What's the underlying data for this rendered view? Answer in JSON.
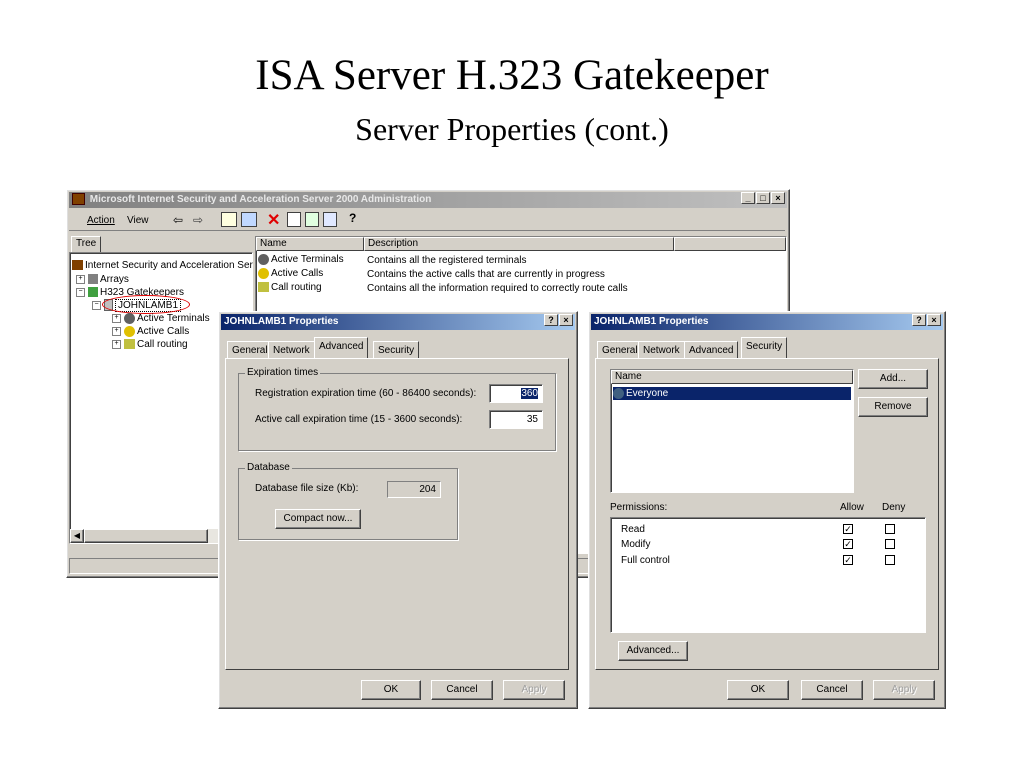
{
  "slide": {
    "title": "ISA Server H.323 Gatekeeper",
    "subtitle": "Server Properties (cont.)"
  },
  "mmc": {
    "title": "Microsoft Internet Security and Acceleration Server 2000 Administration",
    "menu": {
      "action": "Action",
      "view": "View"
    },
    "tree_tab": "Tree",
    "tree": {
      "root": "Internet Security and Acceleration Ser",
      "arrays": "Arrays",
      "gatekeepers": "H323 Gatekeepers",
      "server": "JOHNLAMB1",
      "active_terminals": "Active Terminals",
      "active_calls": "Active Calls",
      "call_routing": "Call routing"
    },
    "columns": {
      "name": "Name",
      "description": "Description"
    },
    "rows": [
      {
        "name": "Active Terminals",
        "description": "Contains all the registered terminals"
      },
      {
        "name": "Active Calls",
        "description": "Contains the active calls that are currently in progress"
      },
      {
        "name": "Call routing",
        "description": "Contains all the information required to correctly route calls"
      }
    ]
  },
  "dialog_advanced": {
    "title": "JOHNLAMB1 Properties",
    "tabs": [
      "General",
      "Network",
      "Advanced",
      "Security"
    ],
    "expiration_group": "Expiration times",
    "registration_label": "Registration expiration time (60 - 86400 seconds):",
    "registration_value": "360",
    "active_call_label": "Active call expiration time (15 - 3600 seconds):",
    "active_call_value": "35",
    "database_group": "Database",
    "db_size_label": "Database file size (Kb):",
    "db_size_value": "204",
    "compact_button": "Compact now...",
    "ok": "OK",
    "cancel": "Cancel",
    "apply": "Apply"
  },
  "dialog_security": {
    "title": "JOHNLAMB1 Properties",
    "tabs": [
      "General",
      "Network",
      "Advanced",
      "Security"
    ],
    "name_header": "Name",
    "names": [
      "Everyone"
    ],
    "add_button": "Add...",
    "remove_button": "Remove",
    "permissions_label": "Permissions:",
    "allow_header": "Allow",
    "deny_header": "Deny",
    "permissions": [
      {
        "name": "Read",
        "allow": true,
        "deny": false
      },
      {
        "name": "Modify",
        "allow": true,
        "deny": false
      },
      {
        "name": "Full control",
        "allow": true,
        "deny": false
      }
    ],
    "advanced_button": "Advanced...",
    "ok": "OK",
    "cancel": "Cancel",
    "apply": "Apply"
  },
  "colors": {
    "titlebar_active": "#0a246a",
    "titlebar_gradient_end": "#a6caf0",
    "face": "#d4d0c8",
    "selection": "#0a246a"
  }
}
